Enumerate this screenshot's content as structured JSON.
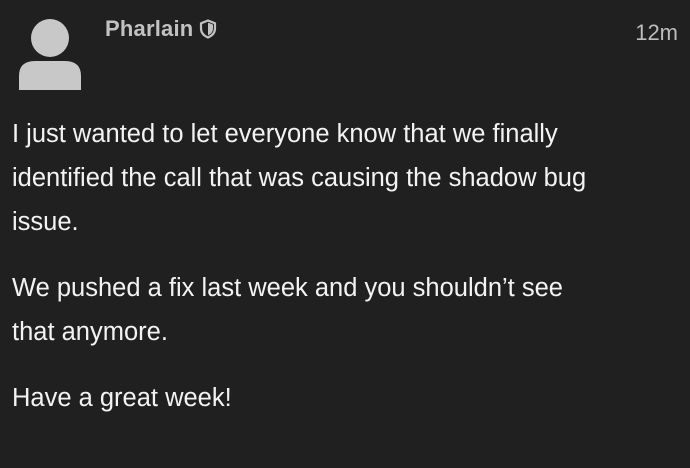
{
  "post": {
    "author": "Pharlain",
    "timestamp": "12m",
    "paragraphs": [
      {
        "lines": [
          "I just wanted to let everyone know that we finally",
          "identified the call that was causing the shadow bug",
          "issue."
        ]
      },
      {
        "lines": [
          "We pushed a fix last week and you shouldn’t see",
          "that anymore."
        ]
      },
      {
        "lines": [
          "Have a great week!"
        ]
      }
    ]
  },
  "icons": {
    "avatar": "default-user-avatar-icon",
    "badge": "shield-icon"
  },
  "colors": {
    "background": "#202020",
    "author": "#c2c2c2",
    "timestamp": "#bdbdbd",
    "body_text": "#f3f3f3",
    "avatar": "#c8c8c8"
  }
}
